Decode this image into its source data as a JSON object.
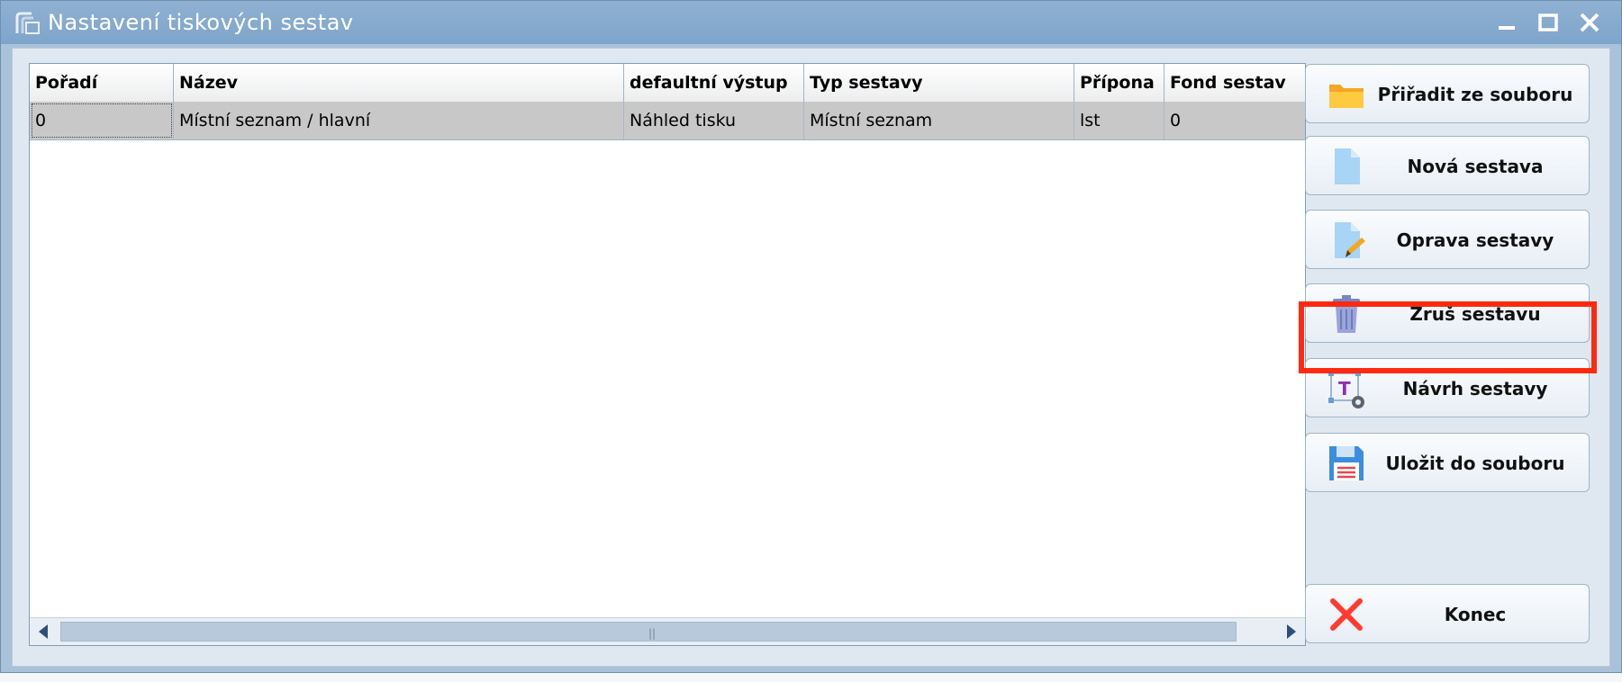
{
  "window": {
    "title": "Nastavení tiskových sestav"
  },
  "table": {
    "columns": [
      "Pořadí",
      "Název",
      "defaultní výstup",
      "Typ sestavy",
      "Přípona",
      "Fond sestav"
    ],
    "rows": [
      [
        "0",
        "Místní seznam / hlavní",
        "Náhled tisku",
        "Místní seznam",
        "lst",
        "0"
      ]
    ],
    "selected_row": 0
  },
  "buttons": {
    "assign_from_file": "Přiřadit ze souboru",
    "new_report": "Nová sestava",
    "edit_report": "Oprava sestavy",
    "delete_report": "Zruš sestavu",
    "design_report": "Návrh sestavy",
    "save_to_file": "Uložit do souboru",
    "close": "Konec"
  },
  "icons": {
    "assign_from_file": "folder-icon",
    "new_report": "document-icon",
    "edit_report": "document-edit-icon",
    "delete_report": "trash-icon",
    "design_report": "design-text-gear-icon",
    "save_to_file": "floppy-disk-icon",
    "close": "close-x-icon"
  },
  "colors": {
    "highlight": "#ff2a10",
    "selected_row": "#c8c8c8",
    "title_bar": "#7ea5ca"
  }
}
